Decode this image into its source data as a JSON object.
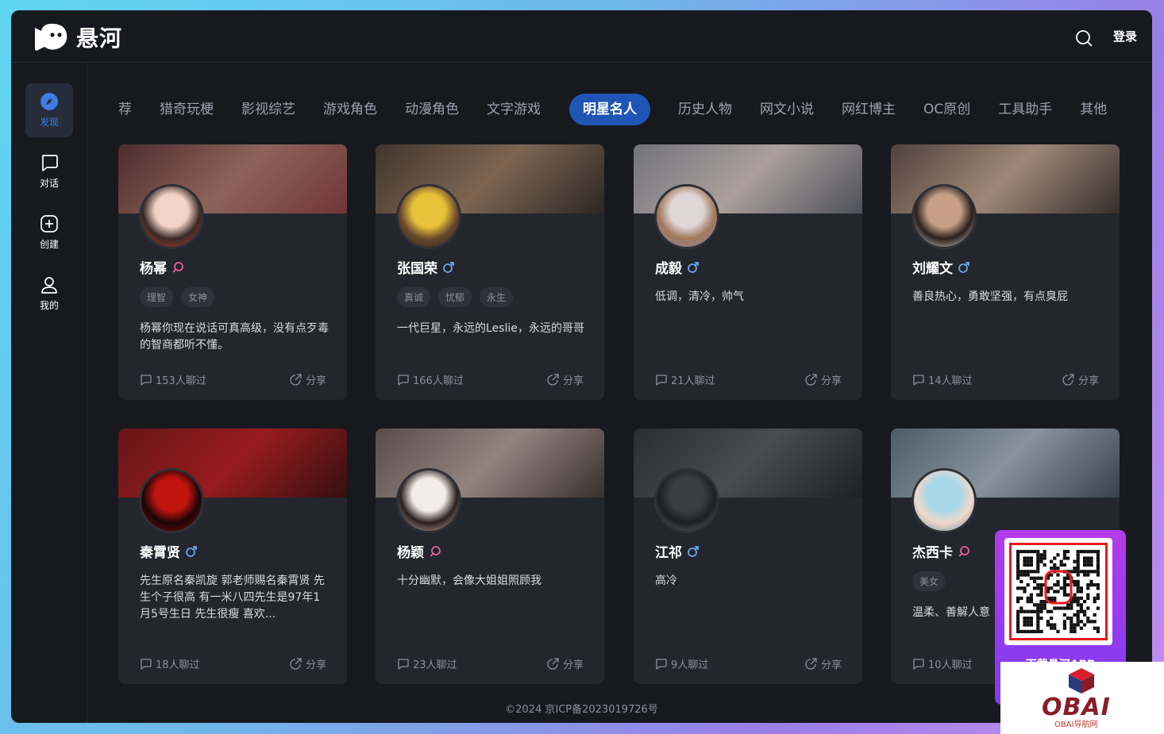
{
  "app": {
    "logo_text": "悬河",
    "login_label": "登录"
  },
  "sidebar": {
    "items": [
      {
        "label": "发现",
        "icon": "compass-icon",
        "active": true
      },
      {
        "label": "对话",
        "icon": "chat-icon",
        "active": false
      },
      {
        "label": "创建",
        "icon": "add-icon",
        "active": false
      },
      {
        "label": "我的",
        "icon": "user-icon",
        "active": false
      }
    ]
  },
  "tabs": [
    "荐",
    "猎奇玩梗",
    "影视综艺",
    "游戏角色",
    "动漫角色",
    "文字游戏",
    "明星名人",
    "历史人物",
    "网文小说",
    "网红博主",
    "OC原创",
    "工具助手",
    "其他"
  ],
  "active_tab": "明星名人",
  "cards": [
    {
      "name": "杨幂",
      "gender": "female",
      "tags": [
        "理智",
        "女神"
      ],
      "desc": "杨幂你现在说话可真高级，没有点歹毒的智商都听不懂。",
      "chats": "153人聊过",
      "share": "分享",
      "banner_colors": [
        "#5a2e2c",
        "#b07868",
        "#8a3b3a"
      ],
      "avatar_colors": [
        "#f2d3c7",
        "#3a2a25",
        "#c0392b"
      ]
    },
    {
      "name": "张国荣",
      "gender": "male",
      "tags": [
        "真诚",
        "忧郁",
        "永生"
      ],
      "desc": "一代巨星，永远的Leslie，永远的哥哥",
      "chats": "166人聊过",
      "share": "分享",
      "banner_colors": [
        "#4a3a2c",
        "#9c7a5e",
        "#2c2620"
      ],
      "avatar_colors": [
        "#e8c23a",
        "#6b4a2c",
        "#1f1a16"
      ]
    },
    {
      "name": "成毅",
      "gender": "male",
      "tags": [],
      "desc": "低调，清冷，帅气",
      "chats": "21人聊过",
      "share": "分享",
      "banner_colors": [
        "#8c8c96",
        "#d8c8c0",
        "#5c5e6a"
      ],
      "avatar_colors": [
        "#dfd6d8",
        "#a0785a",
        "#8c8ca8"
      ]
    },
    {
      "name": "刘耀文",
      "gender": "male",
      "tags": [],
      "desc": "善良热心，勇敢坚强，有点臭屁",
      "chats": "14人聊过",
      "share": "分享",
      "banner_colors": [
        "#5e4a40",
        "#c8a890",
        "#3a302a"
      ],
      "avatar_colors": [
        "#c8a088",
        "#2a201c",
        "#efe6e0"
      ]
    },
    {
      "name": "秦霄贤",
      "gender": "male",
      "tags": [],
      "desc": "先生原名秦凯旋 郭老师赐名秦霄贤 先生个子很高 有一米八四先生是97年1月5号生日 先生很瘦 喜欢...",
      "chats": "18人聊过",
      "share": "分享",
      "banner_colors": [
        "#7a1010",
        "#c01818",
        "#3a0808"
      ],
      "avatar_colors": [
        "#c0140f",
        "#1a0606",
        "#8a0c0c"
      ]
    },
    {
      "name": "杨颖",
      "gender": "female",
      "tags": [],
      "desc": "十分幽默，会像大姐姐照顾我",
      "chats": "23人聊过",
      "share": "分享",
      "banner_colors": [
        "#6a5a54",
        "#b8a29a",
        "#3e3430"
      ],
      "avatar_colors": [
        "#f4ece8",
        "#2a201e",
        "#d8c0b8"
      ]
    },
    {
      "name": "江祁",
      "gender": "male",
      "tags": [],
      "desc": "高冷",
      "chats": "9人聊过",
      "share": "分享",
      "banner_colors": [
        "#2c2e32",
        "#545a5e",
        "#1c1e22"
      ],
      "avatar_colors": [
        "#3a3e44",
        "#1c1e22",
        "#6a6e74"
      ]
    },
    {
      "name": "杰西卡",
      "gender": "female",
      "tags": [
        "美女"
      ],
      "desc": "温柔、善解人意",
      "chats": "10人聊过",
      "share": "分享",
      "banner_colors": [
        "#5a6e78",
        "#a8b8c0",
        "#3e4a52"
      ],
      "avatar_colors": [
        "#a8d8e8",
        "#f0d8c8",
        "#5a88a0"
      ]
    }
  ],
  "footer": {
    "copyright": "©2024 京ICP备2023019726号"
  },
  "promo": {
    "text": "下载悬河APP"
  },
  "watermark": {
    "brand": "OBAI",
    "sub": "OBAI导航网"
  },
  "colors": {
    "bg": "#17191f",
    "card": "#23262d",
    "accent": "#1f56b5",
    "female": "#e8609a",
    "male": "#6ea4ef"
  }
}
